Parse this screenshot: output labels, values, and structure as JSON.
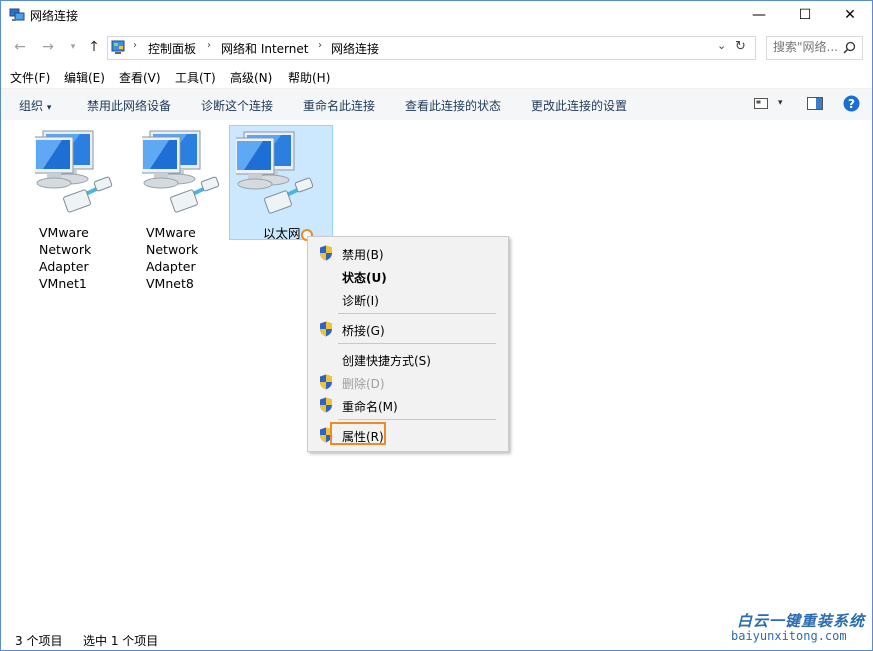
{
  "window": {
    "title": "网络连接",
    "controls": {
      "minimize": "—",
      "maximize": "☐",
      "close": "✕"
    }
  },
  "address": {
    "crumbs": [
      "控制面板",
      "网络和 Internet",
      "网络连接"
    ],
    "search_placeholder": "搜索\"网络..."
  },
  "menubar": {
    "items": [
      "文件(F)",
      "编辑(E)",
      "查看(V)",
      "工具(T)",
      "高级(N)",
      "帮助(H)"
    ]
  },
  "commandbar": {
    "items": [
      "组织",
      "禁用此网络设备",
      "诊断这个连接",
      "重命名此连接",
      "查看此连接的状态",
      "更改此连接的设置"
    ]
  },
  "items": [
    {
      "label": "VMware\nNetwork\nAdapter\nVMnet1",
      "selected": false
    },
    {
      "label": "VMware\nNetwork\nAdapter\nVMnet8",
      "selected": false
    },
    {
      "label": "以太网",
      "selected": true
    }
  ],
  "context_menu": {
    "items": [
      {
        "label": "禁用(B)",
        "shield": true,
        "bold": false,
        "disabled": false
      },
      {
        "label": "状态(U)",
        "shield": false,
        "bold": true,
        "disabled": false
      },
      {
        "label": "诊断(I)",
        "shield": false,
        "bold": false,
        "disabled": false
      },
      {
        "label": "桥接(G)",
        "shield": true,
        "bold": false,
        "disabled": false
      },
      {
        "label": "创建快捷方式(S)",
        "shield": false,
        "bold": false,
        "disabled": false
      },
      {
        "label": "删除(D)",
        "shield": true,
        "bold": false,
        "disabled": true
      },
      {
        "label": "重命名(M)",
        "shield": true,
        "bold": false,
        "disabled": false
      },
      {
        "label": "属性(R)",
        "shield": true,
        "bold": false,
        "disabled": false,
        "highlighted": true
      }
    ]
  },
  "status": {
    "count": "3 个项目",
    "selected": "选中 1 个项目"
  },
  "watermark": {
    "title": "白云一键重装系统",
    "url": "baiyunxitong.com"
  },
  "colors": {
    "accent": "#0078d7",
    "highlight": "#f08a24",
    "selection_bg": "#cce8ff"
  }
}
